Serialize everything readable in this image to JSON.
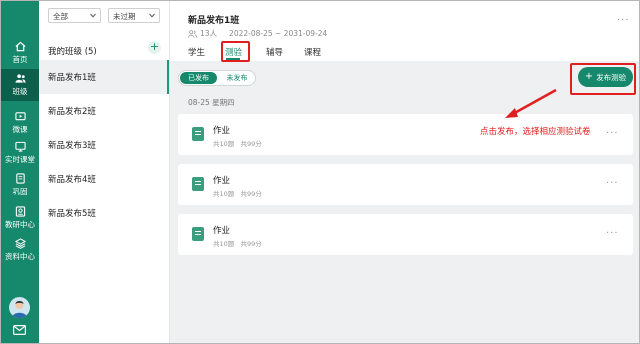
{
  "nav": {
    "items": [
      {
        "label": "首页",
        "icon": "home-icon"
      },
      {
        "label": "班级",
        "icon": "people-icon",
        "active": true
      },
      {
        "label": "微课",
        "icon": "video-icon"
      },
      {
        "label": "实时课堂",
        "icon": "live-icon"
      },
      {
        "label": "巩固",
        "icon": "doc-icon"
      },
      {
        "label": "教研中心",
        "icon": "research-icon"
      },
      {
        "label": "资料中心",
        "icon": "layers-icon"
      }
    ]
  },
  "filters": {
    "scope": "全部",
    "status": "未过期"
  },
  "class_list": {
    "title": "我的班级 (5)",
    "add_label": "+",
    "items": [
      "新品发布1班",
      "新品发布2班",
      "新品发布3班",
      "新品发布4班",
      "新品发布5班"
    ]
  },
  "course": {
    "title": "新品发布1班",
    "members": "13人",
    "dates": "2022-08-25 ~ 2031-09-24",
    "more": "···"
  },
  "tabs": [
    "学生",
    "测验",
    "辅导",
    "课程"
  ],
  "segment": {
    "published": "已发布",
    "unpublished": "未发布"
  },
  "date_group": "08-25 星期四",
  "publish_button": "发布测验",
  "quizzes": [
    {
      "title": "作业",
      "meta": "共10题",
      "score": "共99分"
    },
    {
      "title": "作业",
      "meta": "共10题",
      "score": "共99分"
    },
    {
      "title": "作业",
      "meta": "共10题",
      "score": "共99分"
    }
  ],
  "annotation": "点击发布，选择相应测验试卷",
  "colors": {
    "brand": "#16886c",
    "annotation": "#e02020"
  }
}
